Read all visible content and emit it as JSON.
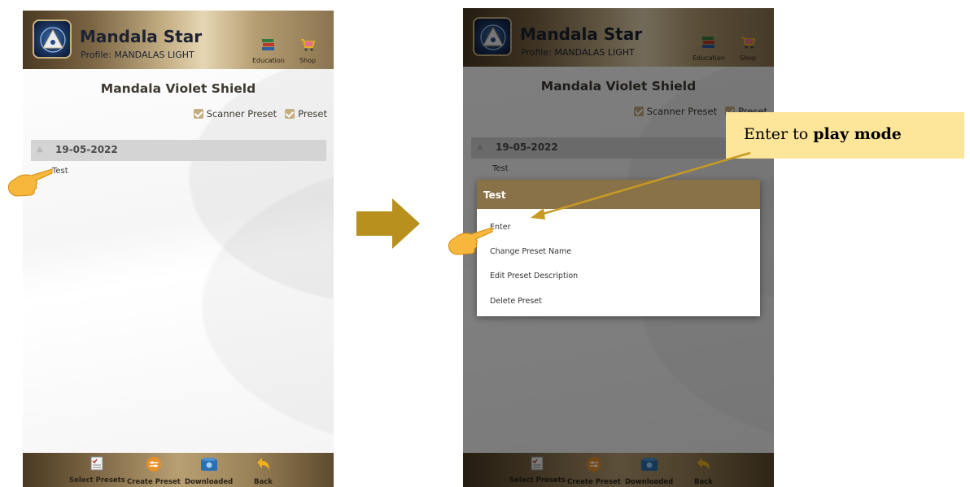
{
  "app": {
    "title": "Mandala Star",
    "profile_label": "Profile:",
    "profile_value": "MANDALAS LIGHT",
    "education_label": "Education",
    "shop_label": "Shop"
  },
  "page": {
    "title": "Mandala Violet Shield",
    "scanner_preset_label": "Scanner Preset",
    "preset_label": "Preset",
    "scanner_preset_checked": true,
    "preset_checked": true
  },
  "list": {
    "date": "19-05-2022",
    "item": "Test"
  },
  "dialog": {
    "title": "Test",
    "options": [
      "Enter",
      "Change Preset Name",
      "Edit Preset Description",
      "Delete Preset"
    ]
  },
  "bottom_nav": {
    "select_presets": "Select Presets",
    "create_preset": "Create Preset",
    "downloaded": "Downloaded",
    "back": "Back"
  },
  "callout": {
    "prefix": "Enter to",
    "bold": "play mode"
  },
  "colors": {
    "header_gold": "#c2ac82",
    "checkbox": "#c4ad80",
    "dialog_header": "#8a7248",
    "callout_bg": "#fde59a",
    "arrow": "#b8901e"
  }
}
